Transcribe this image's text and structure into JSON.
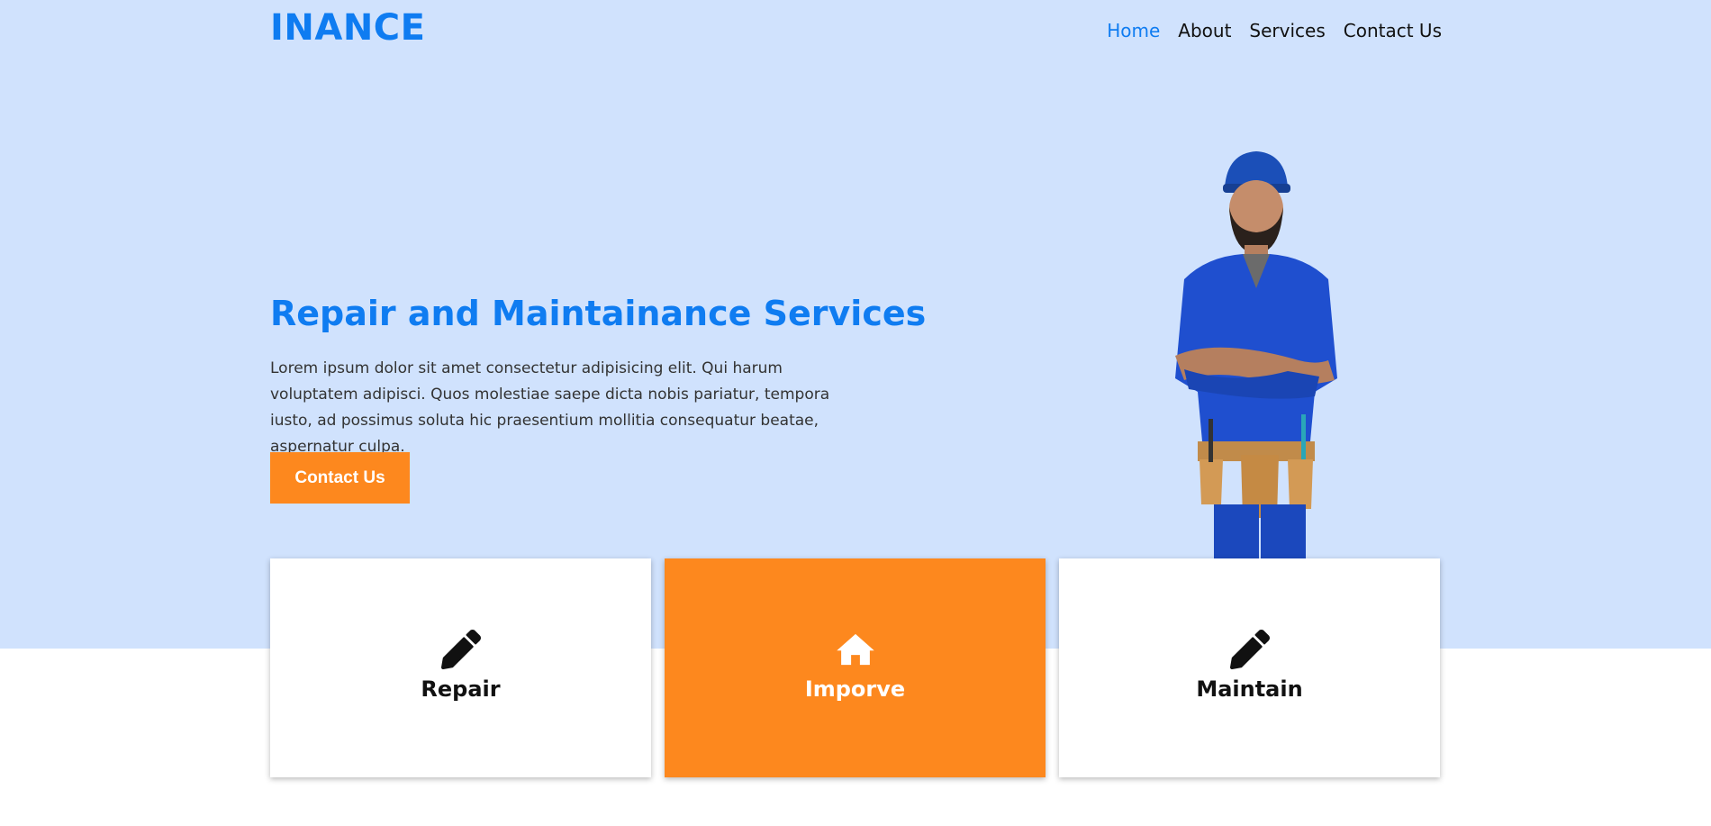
{
  "header": {
    "logo": "INANCE",
    "nav": [
      {
        "label": "Home",
        "active": true
      },
      {
        "label": "About",
        "active": false
      },
      {
        "label": "Services",
        "active": false
      },
      {
        "label": "Contact Us",
        "active": false
      }
    ]
  },
  "hero": {
    "title": "Repair and Maintainance Services",
    "description": "Lorem ipsum dolor sit amet consectetur adipisicing elit. Qui harum voluptatem adipisci. Quos molestiae saepe dicta nobis pariatur, tempora iusto, ad possimus soluta hic praesentium mollitia consequatur beatae, aspernatur culpa.",
    "button_label": "Contact Us",
    "image": "worker-illustration"
  },
  "cards": [
    {
      "label": "Repair",
      "icon": "pencil-icon"
    },
    {
      "label": "Imporve",
      "icon": "home-icon"
    },
    {
      "label": "Maintain",
      "icon": "pencil-icon"
    }
  ],
  "colors": {
    "accent": "#0f7cf1",
    "orange": "#fd881e",
    "hero_bg": "#d0e2fd",
    "text": "#333333"
  }
}
